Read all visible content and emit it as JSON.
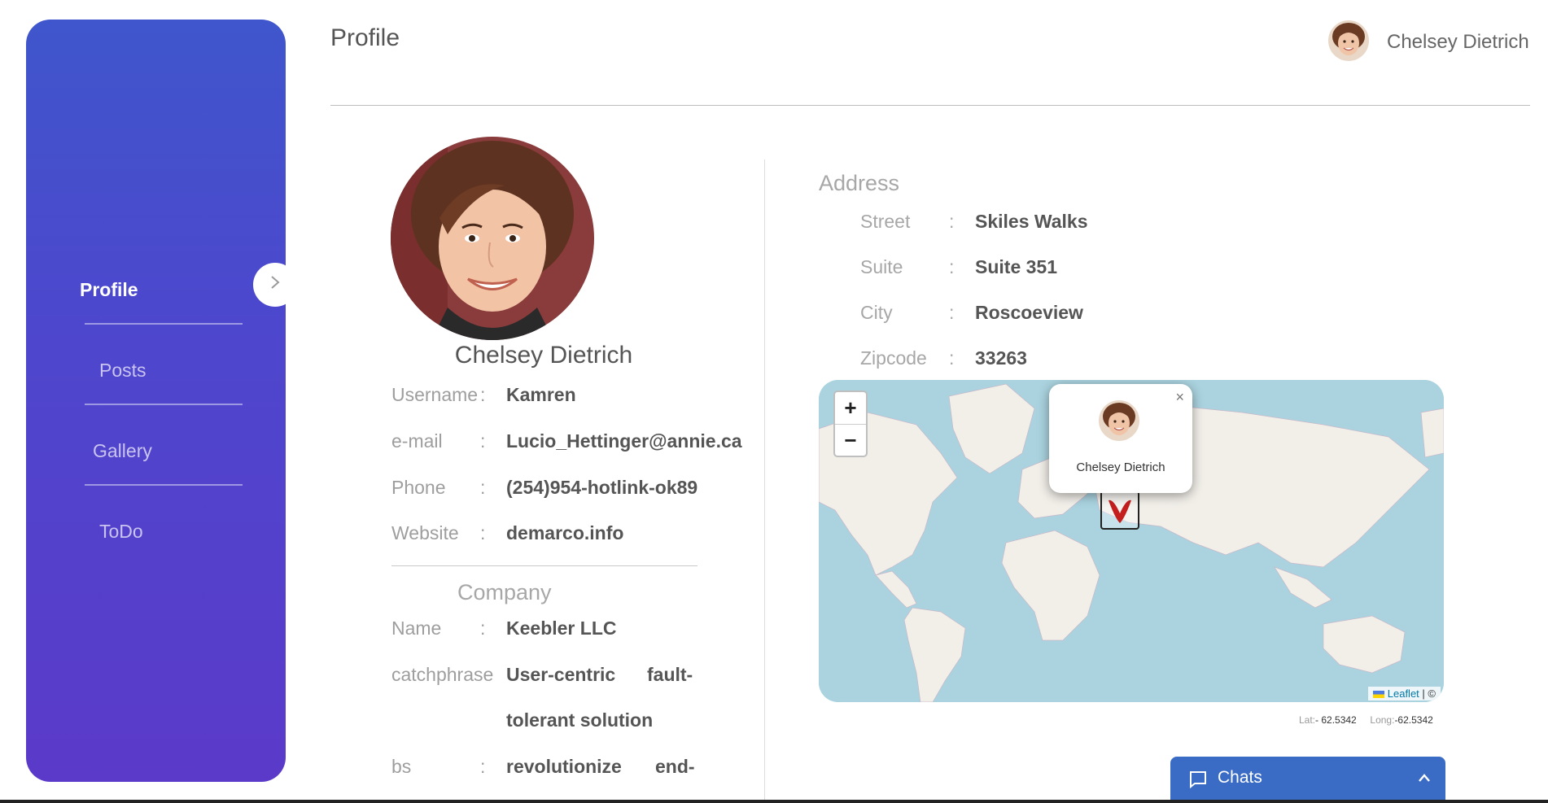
{
  "sidebar": {
    "items": [
      {
        "label": "Profile",
        "active": true
      },
      {
        "label": "Posts",
        "active": false
      },
      {
        "label": "Gallery",
        "active": false
      },
      {
        "label": "ToDo",
        "active": false
      }
    ],
    "gradient_top": "#3f56cc",
    "gradient_bottom": "#5b3ac9"
  },
  "header": {
    "title": "Profile",
    "user_name": "Chelsey Dietrich"
  },
  "profile": {
    "name": "Chelsey Dietrich",
    "fields": [
      {
        "label": "Username",
        "colon": ":",
        "value": "Kamren"
      },
      {
        "label": "e-mail",
        "colon": ":",
        "value": "Lucio_Hettinger@annie.ca"
      },
      {
        "label": "Phone",
        "colon": ":",
        "value": "(254)954-hotlink-ok89"
      },
      {
        "label": "Website",
        "colon": ":",
        "value": "demarco.info"
      }
    ]
  },
  "company": {
    "title": "Company",
    "fields": [
      {
        "label": "Name",
        "colon": ":",
        "value": "Keebler LLC"
      },
      {
        "label": "catchphrase",
        "colon": "",
        "value_a": "User-centric",
        "value_b": "fault-",
        "value_c": "tolerant solution"
      },
      {
        "label": "bs",
        "colon": ":",
        "value_a": "revolutionize",
        "value_b": "end-"
      }
    ]
  },
  "address": {
    "title": "Address",
    "fields": [
      {
        "label": "Street",
        "colon": ":",
        "value": "Skiles Walks"
      },
      {
        "label": "Suite",
        "colon": ":",
        "value": "Suite 351"
      },
      {
        "label": "City",
        "colon": ":",
        "value": "Roscoeview"
      },
      {
        "label": "Zipcode",
        "colon": ":",
        "value": "33263"
      }
    ]
  },
  "map": {
    "zoom_in": "+",
    "zoom_out": "−",
    "popup_name": "Chelsey Dietrich",
    "popup_close": "×",
    "attribution_leaflet": "Leaflet",
    "attribution_rest": "| ©",
    "lat_label": "Lat:",
    "lat_value": "- 62.5342",
    "long_label": "Long:",
    "long_value": "-62.5342"
  },
  "chats": {
    "label": "Chats",
    "color": "#3a6cc6"
  }
}
